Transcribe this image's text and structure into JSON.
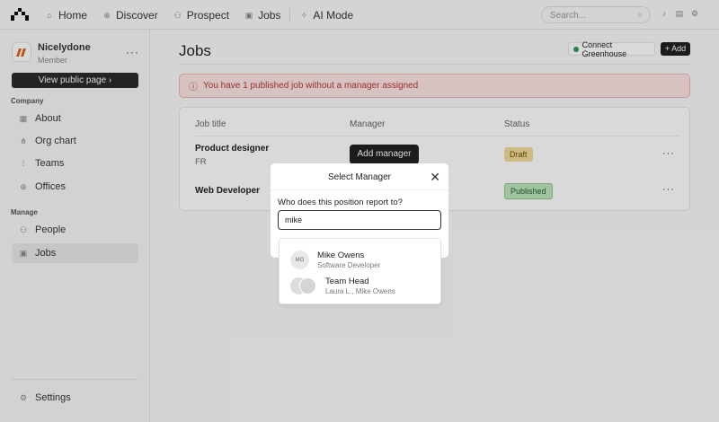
{
  "nav": {
    "items": [
      {
        "label": "Home",
        "icon": "home-icon"
      },
      {
        "label": "Discover",
        "icon": "globe-icon"
      },
      {
        "label": "Prospect",
        "icon": "people-icon"
      },
      {
        "label": "Jobs",
        "icon": "briefcase-icon"
      },
      {
        "label": "AI Mode",
        "icon": "ai-icon"
      }
    ],
    "search_placeholder": "Search..."
  },
  "org": {
    "name": "Nicelydone",
    "role": "Member",
    "view_public": "View public page"
  },
  "sidebar": {
    "company_label": "Company",
    "company": [
      "About",
      "Org chart",
      "Teams",
      "Offices"
    ],
    "manage_label": "Manage",
    "manage": [
      "People",
      "Jobs"
    ],
    "settings": "Settings"
  },
  "page": {
    "title": "Jobs",
    "connect": "Connect Greenhouse",
    "add": "+ Add",
    "alert": "You have 1 published job without a manager assigned"
  },
  "table": {
    "headers": [
      "Job title",
      "Manager",
      "Status"
    ],
    "rows": [
      {
        "title": "Product designer",
        "location": "FR",
        "manager_action": "Add manager",
        "status": "Draft"
      },
      {
        "title": "Web Developer",
        "status": "Published"
      }
    ]
  },
  "modal": {
    "title": "Select Manager",
    "question": "Who does this position report to?",
    "input_value": "mike",
    "options": [
      {
        "initials": "MO",
        "name": "Mike Owens",
        "subtitle": "Software Developer"
      },
      {
        "name": "Team Head",
        "subtitle": "Laura L., Mike Owens"
      }
    ]
  },
  "colors": {
    "draft": "#f3dc9a",
    "published": "#bfe5bf",
    "alert": "#b73838"
  }
}
